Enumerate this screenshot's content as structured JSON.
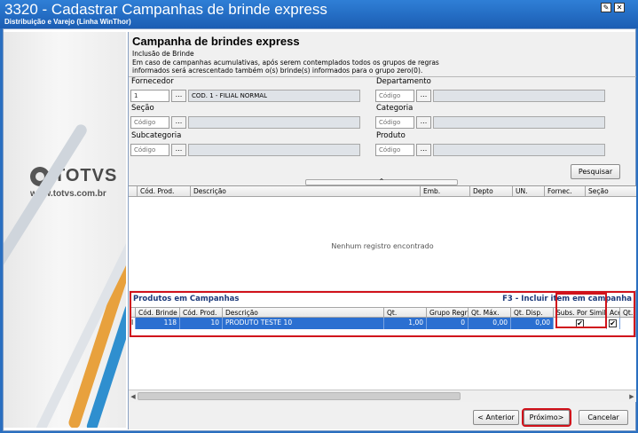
{
  "window": {
    "title": "3320 - Cadastrar Campanhas de brinde express",
    "subtitle": "Distribuição e Varejo (Linha WinThor)"
  },
  "sidebar": {
    "logo_text": "TOTVS",
    "website": "www.totvs.com.br"
  },
  "header": {
    "title": "Campanha de brindes express",
    "subtitle": "Inclusão de Brinde",
    "description": "Em caso de campanhas acumulativas, após serem contemplados todos os grupos de regras informados será acrescentado também o(s) brinde(s) informados para o grupo zero(0)."
  },
  "filters": {
    "fornecedor": {
      "label": "Fornecedor",
      "code": "1",
      "name": "COD. 1 - FILIAL NORMAL"
    },
    "departamento": {
      "label": "Departamento",
      "placeholder": "Código"
    },
    "secao": {
      "label": "Seção",
      "placeholder": "Código"
    },
    "categoria": {
      "label": "Categoria",
      "placeholder": "Código"
    },
    "subcategoria": {
      "label": "Subcategoria",
      "placeholder": "Código"
    },
    "produto": {
      "label": "Produto",
      "placeholder": "Código"
    },
    "lookup_label": "...",
    "search_button": "Pesquisar"
  },
  "results_grid": {
    "columns": [
      "Cód. Prod.",
      "Descrição",
      "Emb.",
      "Depto",
      "UN.",
      "Fornec.",
      "Seção"
    ],
    "empty_message": "Nenhum registro encontrado"
  },
  "campaign_products": {
    "title": "Produtos em Campanhas",
    "hint": "F3 - Incluir item em campanha",
    "columns": [
      "Cód. Brinde",
      "Cód. Prod.",
      "Descrição",
      "Qt.",
      "Grupo Regra",
      "Qt. Máx.",
      "Qt. Disp.",
      "Subs. Por Similar",
      "Aceita",
      "Qt."
    ],
    "rows": [
      {
        "marker": "I",
        "cod_brinde": "118",
        "cod_prod": "10",
        "descricao": "PRODUTO TESTE 10",
        "qt": "1,00",
        "grupo_regra": "0",
        "qt_max": "0,00",
        "qt_disp": "0,00",
        "subs_por_similar": true,
        "aceita": true
      }
    ]
  },
  "footer": {
    "back_button": "< Anterior",
    "next_button": "Próximo>",
    "cancel_button": "Cancelar"
  },
  "colors": {
    "title_bar": "#1b5db3",
    "selection": "#2b6fd1",
    "highlight": "#d0121b",
    "section_title": "#1c3a7a"
  }
}
